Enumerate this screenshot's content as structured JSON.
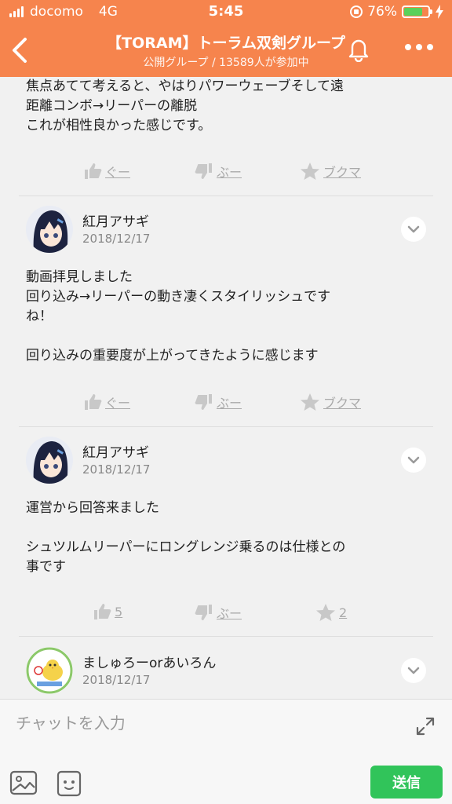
{
  "status_bar": {
    "carrier": "docomo",
    "network": "4G",
    "time": "5:45",
    "battery": "76%",
    "battery_level": 0.76
  },
  "header": {
    "title": "【TORAM】トーラム双剣グループ",
    "subtitle": "公開グループ / 13589人が参加中"
  },
  "post": {
    "text": "焦点あてて考えると、やはりパワーウェーブそして遠\n距離コンボ→リーパーの離脱\nこれが相性良かった感じです。",
    "actions": {
      "like": "ぐー",
      "dislike": "ぶー",
      "bookmark": "ブクマ"
    }
  },
  "comments": [
    {
      "name": "紅月アサギ",
      "date": "2018/12/17",
      "text": "動画拝見しました\n回り込み→リーパーの動き凄くスタイリッシュです\nね！\n\n回り込みの重要度が上がってきたように感じます",
      "actions": {
        "like": "ぐー",
        "dislike": "ぶー",
        "bookmark": "ブクマ"
      }
    },
    {
      "name": "紅月アサギ",
      "date": "2018/12/17",
      "text": "運営から回答来ました\n\nシュツルムリーパーにロングレンジ乗るのは仕様との\n事です",
      "actions": {
        "like": "5",
        "dislike": "ぶー",
        "bookmark": "2"
      }
    },
    {
      "name": "ましゅろーorあいろん",
      "date": "2018/12/17"
    }
  ],
  "composer": {
    "placeholder": "チャットを入力",
    "send_label": "送信"
  },
  "colors": {
    "header": "#f6844d",
    "send": "#31c45a"
  }
}
